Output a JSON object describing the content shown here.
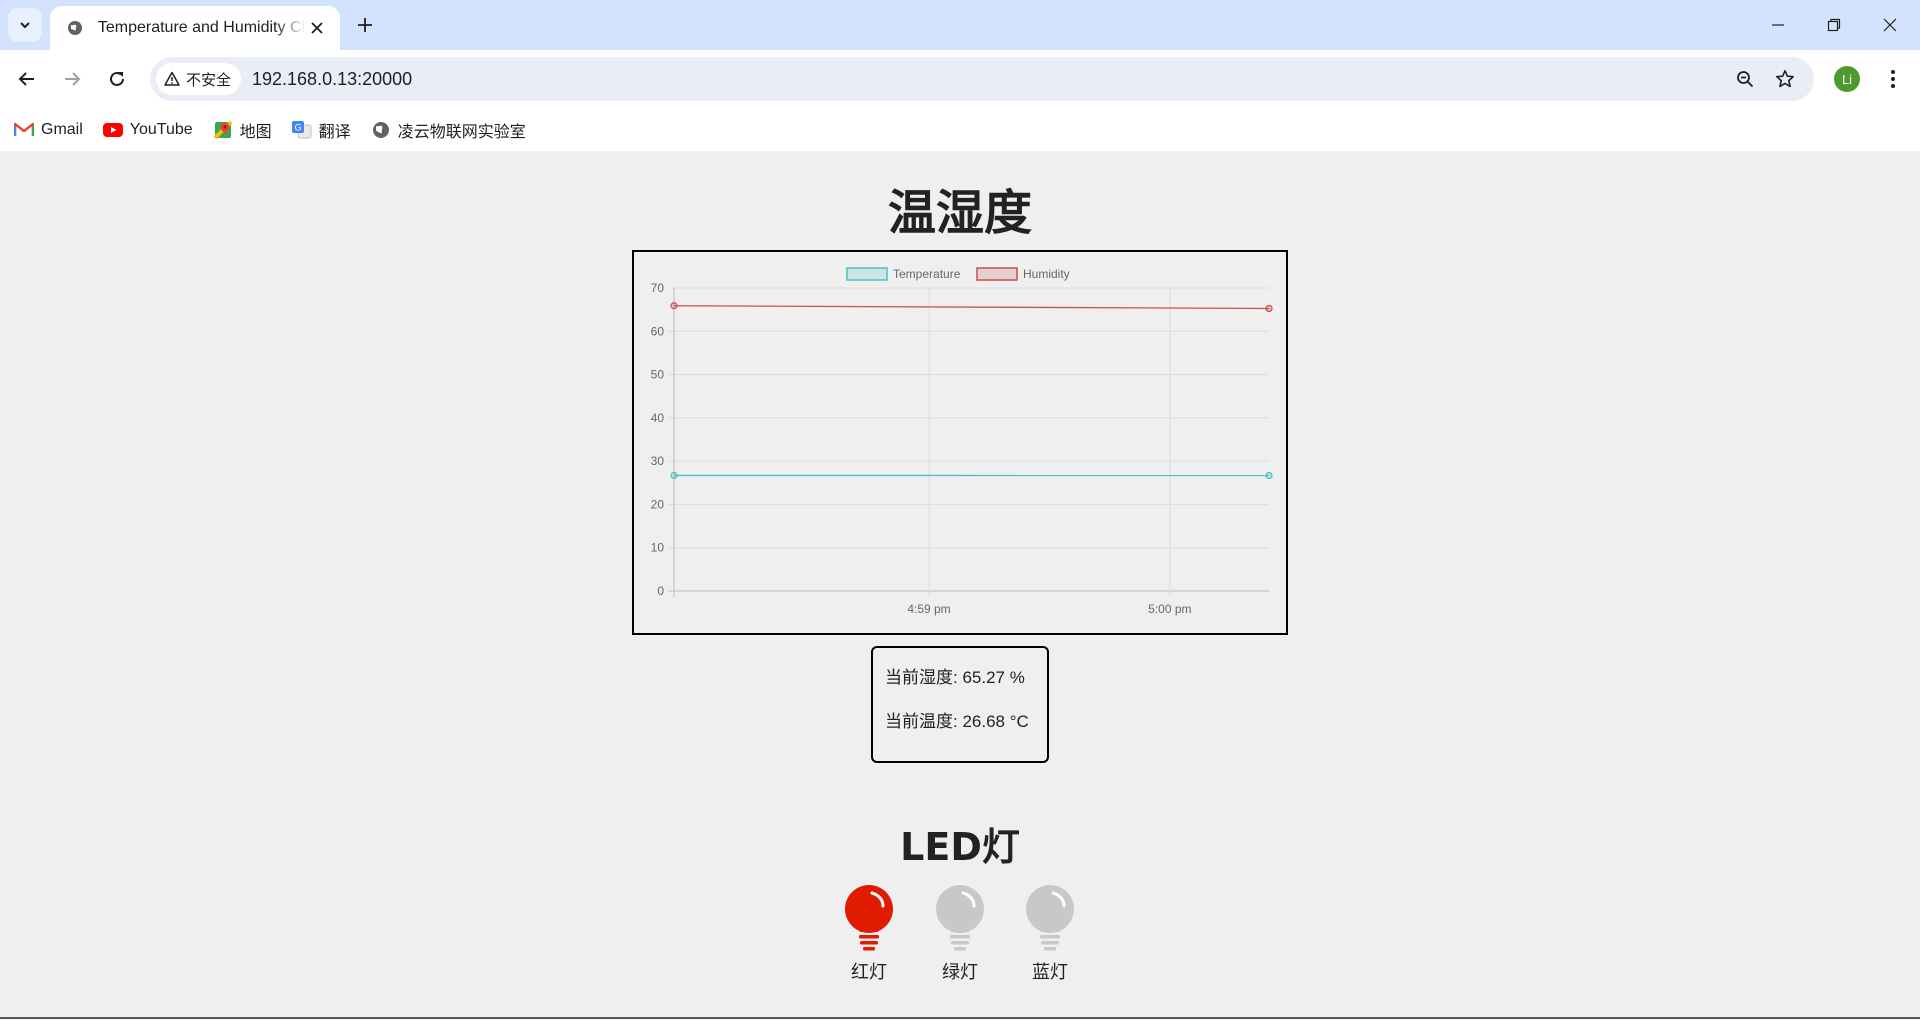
{
  "browser": {
    "tab_title": "Temperature and Humidity Chart",
    "url": "192.168.0.13:20000",
    "security_label": "不安全",
    "profile_initial": "Li",
    "bookmarks": [
      {
        "label": "Gmail",
        "icon": "gmail-icon"
      },
      {
        "label": "YouTube",
        "icon": "youtube-icon"
      },
      {
        "label": "地图",
        "icon": "maps-icon"
      },
      {
        "label": "翻译",
        "icon": "translate-icon"
      },
      {
        "label": "凌云物联网实验室",
        "icon": "globe-icon"
      }
    ]
  },
  "page": {
    "title": "温湿度",
    "humidity_label": "当前湿度: 65.27 %",
    "temperature_label": "当前温度: 26.68 °C",
    "led_section_title": "LED灯",
    "leds": [
      {
        "label": "红灯",
        "on": true,
        "color": "#e01b00"
      },
      {
        "label": "绿灯",
        "on": false,
        "color": "#c8c8c8"
      },
      {
        "label": "蓝灯",
        "on": false,
        "color": "#c8c8c8"
      }
    ]
  },
  "chart_data": {
    "type": "line",
    "legend_position": "top",
    "grid": true,
    "ylim": [
      0,
      70
    ],
    "yticks": [
      0,
      10,
      20,
      30,
      40,
      50,
      60,
      70
    ],
    "x_tick_labels": [
      "4:59 pm",
      "5:00 pm"
    ],
    "x_time_range_min": [
      16.965,
      17.007
    ],
    "x_tick_times": [
      16.983,
      17.0
    ],
    "series": [
      {
        "name": "Temperature",
        "color": "#4bc0c0",
        "points": [
          [
            16.965,
            26.7
          ],
          [
            17.007,
            26.68
          ]
        ]
      },
      {
        "name": "Humidity",
        "color": "#c45050",
        "points": [
          [
            16.965,
            65.9
          ],
          [
            17.007,
            65.27
          ]
        ]
      }
    ]
  }
}
